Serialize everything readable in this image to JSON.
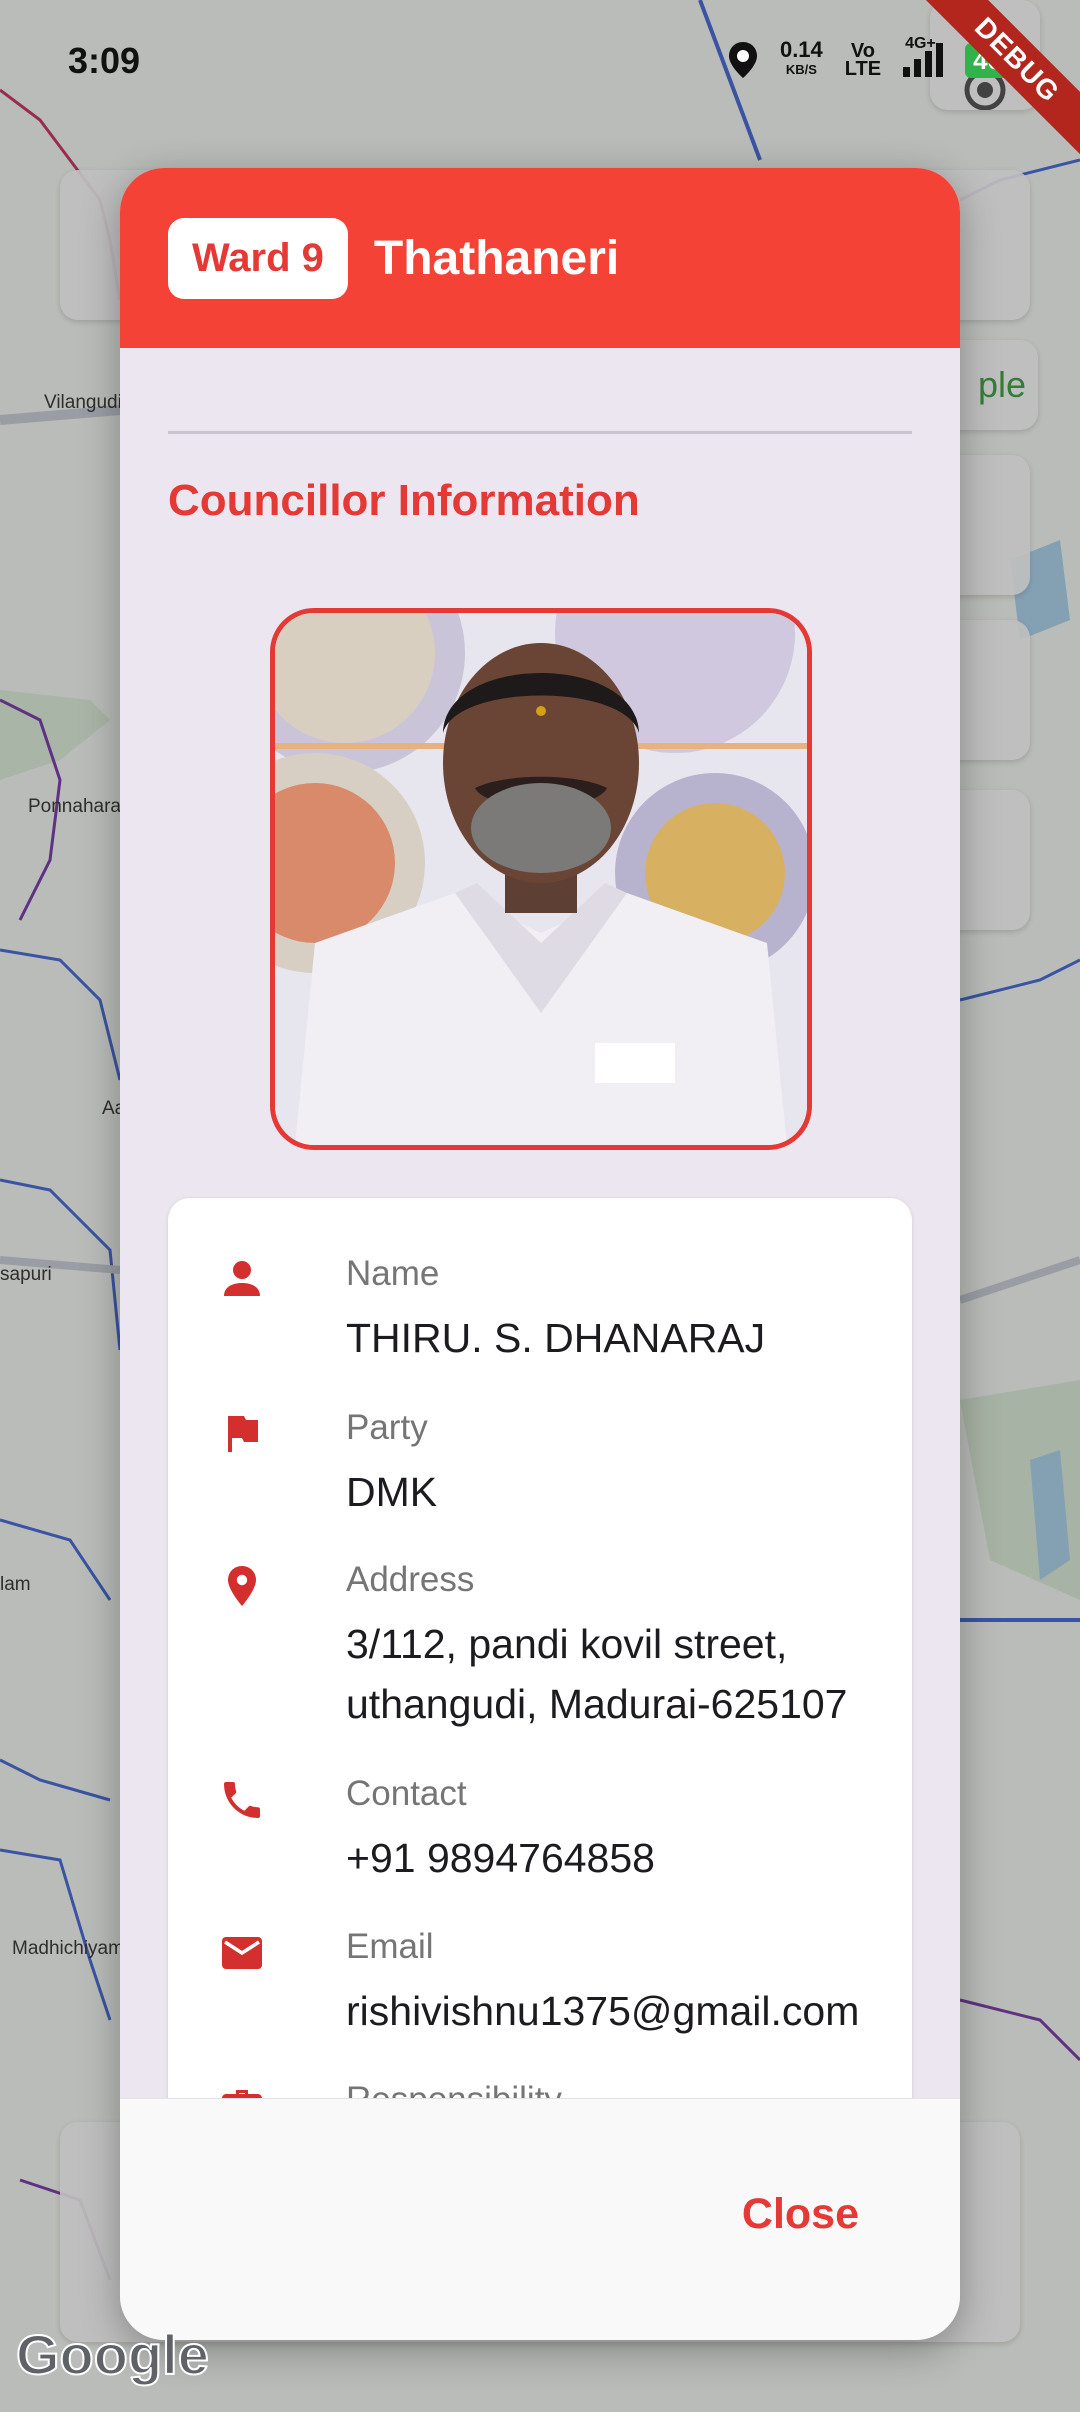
{
  "status_bar": {
    "time": "3:09",
    "speed_value": "0.14",
    "speed_unit": "KB/S",
    "volte_top": "Vo",
    "volte_bottom": "LTE",
    "network": "4G+",
    "battery": "40",
    "icons": [
      "location-icon",
      "signal-icon",
      "battery-icon"
    ]
  },
  "debug_banner": "DEBUG",
  "map": {
    "labels": [
      "Vilangudi",
      "Ponnahara",
      "Aa",
      "sapuri",
      "lam",
      "Madhichiyam"
    ],
    "partial_chip": "ple",
    "attribution": "Google"
  },
  "dialog": {
    "ward_badge": "Ward 9",
    "ward_name": "Thathaneri",
    "section_title": "Councillor Information",
    "photo_icon": "councillor-portrait",
    "fields": [
      {
        "icon": "person-icon",
        "label": "Name",
        "value": "THIRU. S. DHANARAJ"
      },
      {
        "icon": "flag-icon",
        "label": "Party",
        "value": "DMK"
      },
      {
        "icon": "location-pin-icon",
        "label": "Address",
        "value_line1": "3/112, pandi kovil street,",
        "value_line2": "uthangudi, Madurai-625107"
      },
      {
        "icon": "phone-icon",
        "label": "Contact",
        "value": "+91 9894764858"
      },
      {
        "icon": "email-icon",
        "label": "Email",
        "value": "rishivishnu1375@gmail.com"
      },
      {
        "icon": "briefcase-icon",
        "label": "Responsibility"
      }
    ],
    "close_label": "Close"
  },
  "colors": {
    "accent": "#f44336",
    "accent_text": "#e53935",
    "dialog_bg": "#ece6f0"
  }
}
